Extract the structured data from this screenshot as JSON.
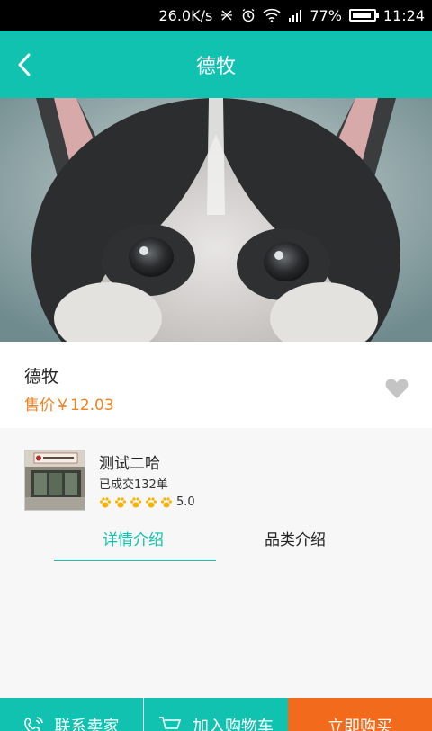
{
  "status_bar": {
    "net_speed": "26.0K/s",
    "battery_pct": "77%",
    "time": "11:24"
  },
  "header": {
    "title": "德牧"
  },
  "product": {
    "name": "德牧",
    "price_label": "售价￥12.03"
  },
  "shop": {
    "name": "测试二哈",
    "sold": "已成交132单",
    "rating": "5.0"
  },
  "tabs": [
    {
      "label": "详情介绍",
      "active": true
    },
    {
      "label": "品类介绍",
      "active": false
    }
  ],
  "bottom_bar": {
    "contact_label": "联系卖家",
    "cart_label": "加入购物车",
    "buy_label": "立即购买"
  },
  "colors": {
    "accent": "#11c2b1",
    "price": "#f5821f",
    "buy": "#f26b1d"
  },
  "icons": [
    "back-arrow-icon",
    "heart-icon",
    "paw-icon",
    "contact-icon",
    "cart-icon"
  ]
}
